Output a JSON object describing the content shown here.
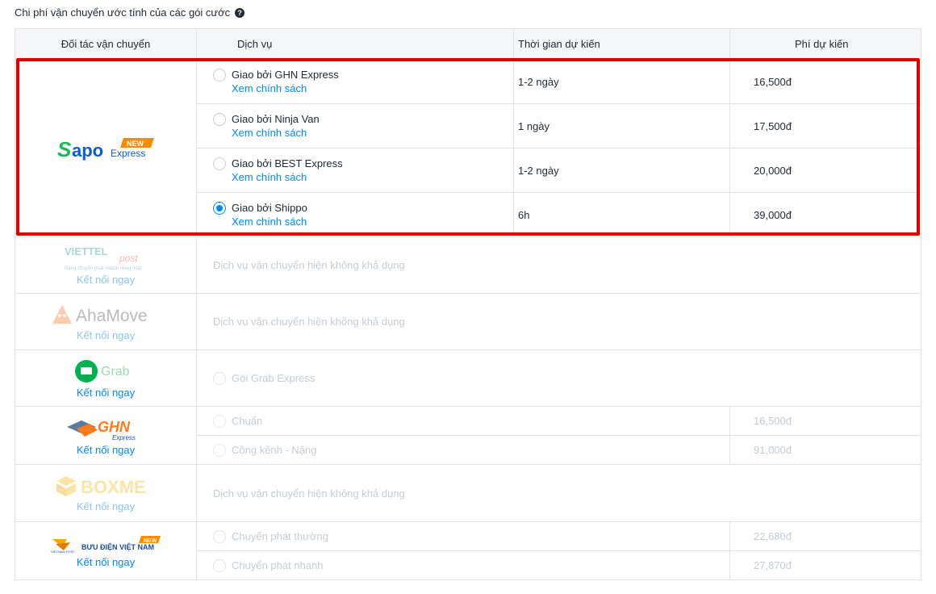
{
  "heading": "Chi phí vận chuyển ước tính của các gói cước",
  "help_icon": "question-circle-icon",
  "columns": {
    "partner": "Đối tác vận chuyển",
    "service": "Dịch vụ",
    "eta": "Thời gian dự kiến",
    "fee": "Phí dự kiến"
  },
  "sapo": {
    "logo_text": "Sapo",
    "logo_sub": "Express",
    "badge": "NEW",
    "services": [
      {
        "name": "Giao bởi GHN Express",
        "link": "Xem chính sách",
        "eta": "1-2 ngày",
        "fee": "16,500đ",
        "selected": false
      },
      {
        "name": "Giao bởi Ninja Van",
        "link": "Xem chính sách",
        "eta": "1 ngày",
        "fee": "17,500đ",
        "selected": false
      },
      {
        "name": "Giao bởi BEST Express",
        "link": "Xem chính sách",
        "eta": "1-2 ngày",
        "fee": "20,000đ",
        "selected": false
      },
      {
        "name": "Giao bởi Shippo",
        "link": "Xem chính sách",
        "eta": "6h",
        "fee": "39,000đ",
        "selected": true
      }
    ]
  },
  "viettel": {
    "logo_text": "VIETTEL",
    "logo_sub": "post",
    "tagline": "Nâng chuyển phát nhanh nâng nhất",
    "connect": "Kết nối ngay",
    "message": "Dịch vụ vận chuyển hiện không khả dụng"
  },
  "ahamove": {
    "logo_text": "AhaMove",
    "connect": "Kết nối ngay",
    "message": "Dịch vụ vận chuyển hiện không khả dụng"
  },
  "grab": {
    "logo_text": "Grab",
    "connect": "Kết nối ngay",
    "service": "Gói Grab Express"
  },
  "ghn": {
    "logo_text": "GHN",
    "logo_sub": "Express",
    "connect": "Kết nối ngay",
    "services": [
      {
        "name": "Chuẩn",
        "fee": "16,500đ"
      },
      {
        "name": "Cồng kềnh - Nặng",
        "fee": "91,000đ"
      }
    ]
  },
  "boxme": {
    "logo_text": "BOXME",
    "connect": "Kết nối ngay",
    "message": "Dịch vụ vận chuyển hiện không khả dụng"
  },
  "vnpost": {
    "logo_text": "BƯU ĐIỆN VIỆT NAM",
    "logo_small": "VIETNAM POST",
    "badge": "NEW",
    "connect": "Kết nối ngay",
    "services": [
      {
        "name": "Chuyển phát thường",
        "fee": "22,680đ"
      },
      {
        "name": "Chuyển phát nhanh",
        "fee": "27,870đ"
      }
    ]
  },
  "colors": {
    "accent": "#0088ff",
    "highlight": "#e00000",
    "sapo_green": "#1db954",
    "sapo_blue": "#0a5bd6",
    "badge_orange": "#ff8a00"
  }
}
